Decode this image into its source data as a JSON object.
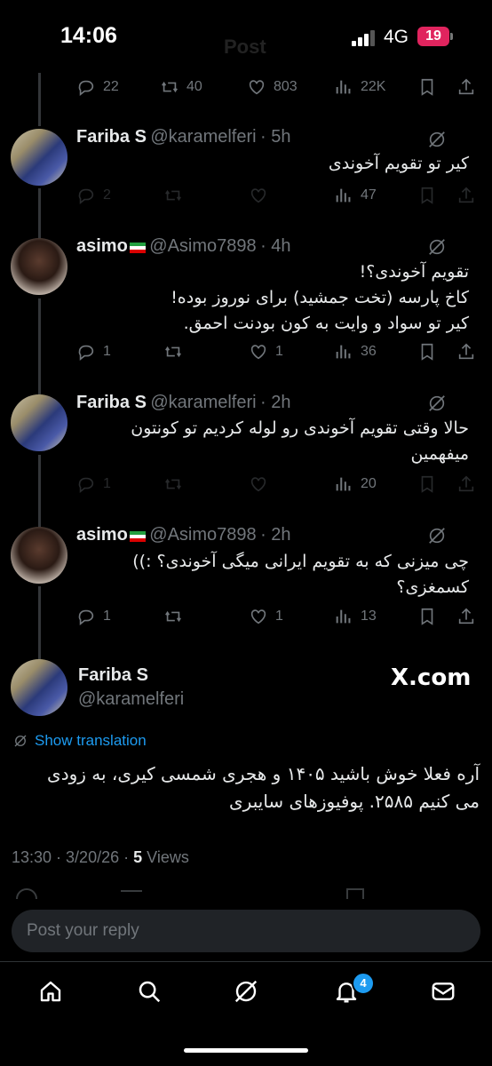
{
  "status_bar": {
    "time": "14:06",
    "network": "4G",
    "battery": "19",
    "header_title": "Post"
  },
  "top_actions": {
    "replies": "22",
    "reposts": "40",
    "likes": "803",
    "views": "22K"
  },
  "replies": [
    {
      "name": "Fariba S",
      "handle": "@karamelferi",
      "time": "· 5h",
      "text_lines": [
        "کیر تو تقویم آخوندی"
      ],
      "replies": "2",
      "reposts": "",
      "likes": "",
      "views": "47"
    },
    {
      "name": "asimo",
      "handle": "@Asimo7898",
      "time": "· 4h",
      "text_lines": [
        "تقویم آخوندی؟!",
        "کاخ پارسه (تخت جمشید) برای نوروز بوده!",
        "کیر تو سواد و وایت به کون بودنت احمق."
      ],
      "replies": "1",
      "reposts": "",
      "likes": "1",
      "views": "36"
    },
    {
      "name": "Fariba S",
      "handle": "@karamelferi",
      "time": "· 2h",
      "text_lines": [
        "حالا وقتی تقویم آخوندی رو لوله کردیم تو کونتون",
        "میفهمین"
      ],
      "replies": "1",
      "reposts": "",
      "likes": "",
      "views": "20"
    },
    {
      "name": "asimo",
      "handle": "@Asimo7898",
      "time": "· 2h",
      "text_lines": [
        "چی میزنی که به تقویم ایرانی میگی آخوندی؟ :))",
        "کسمغزی؟"
      ],
      "replies": "1",
      "reposts": "",
      "likes": "1",
      "views": "13"
    }
  ],
  "focused_post": {
    "name": "Fariba S",
    "handle": "@karamelferi",
    "source": "X.com",
    "show_translation": "Show translation",
    "text_lines": [
      "آره فعلا خوش باشید ۱۴۰۵ و هجری شمسی کیری، به زودی",
      "می کنیم ۲۵۸۵. پوفیوزهای سایبری"
    ],
    "timestamp": "13:30 · 3/20/26 ·",
    "views_count": "5",
    "views_label": "Views"
  },
  "reply_box": {
    "placeholder": "Post your reply"
  },
  "bottom_nav": {
    "notifications_badge": "4",
    "items": [
      "home-icon",
      "search-icon",
      "grok-icon",
      "notifications-icon",
      "messages-icon"
    ]
  },
  "colors": {
    "background": "#000000",
    "accent": "#1d9bf0",
    "secondary_text": "#71767b"
  }
}
